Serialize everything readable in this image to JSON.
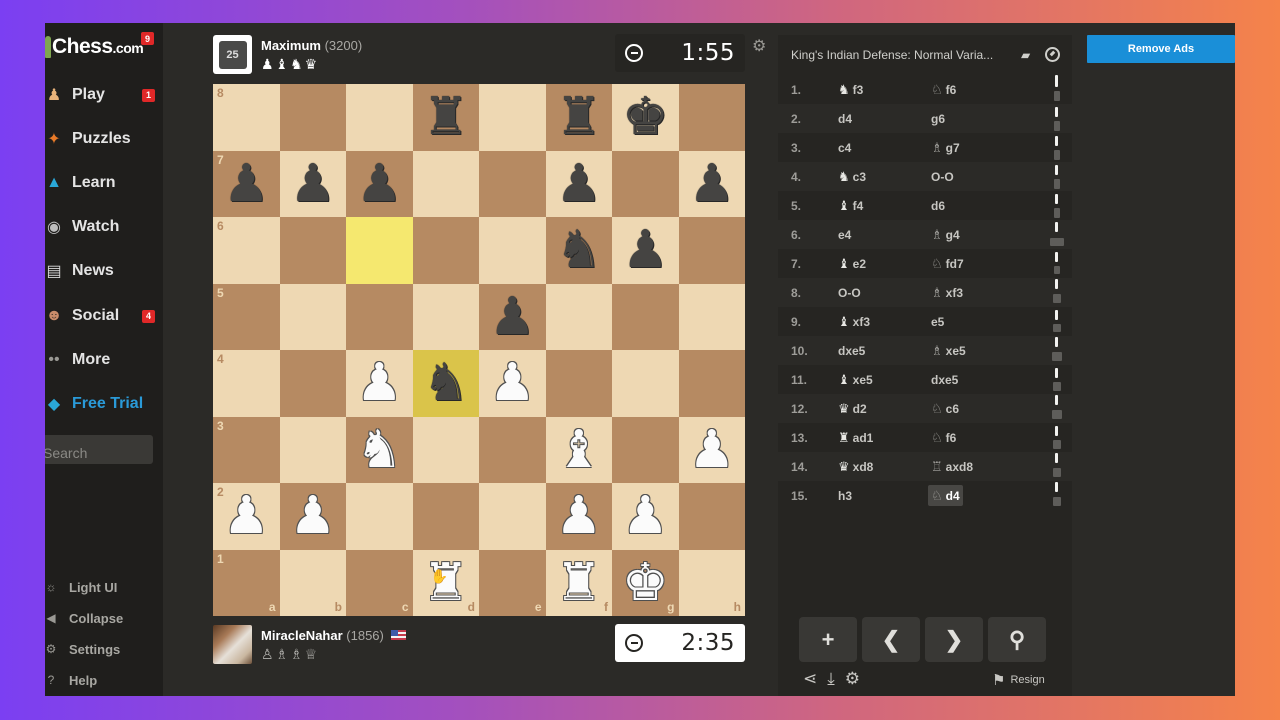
{
  "sidebar": {
    "logo": {
      "main": "Chess",
      "suffix": ".com",
      "badge": "9"
    },
    "items": [
      {
        "label": "Play",
        "icon": "play-icon",
        "glyph": "♟",
        "color": "#e7b27a",
        "badge": "1"
      },
      {
        "label": "Puzzles",
        "icon": "puzzle-icon",
        "glyph": "✦",
        "color": "#e87a28",
        "badge": null
      },
      {
        "label": "Learn",
        "icon": "graduation-cap-icon",
        "glyph": "▲",
        "color": "#2aa8d8",
        "badge": null
      },
      {
        "label": "Watch",
        "icon": "binoculars-icon",
        "glyph": "◉",
        "color": "#bdbdbd",
        "badge": null
      },
      {
        "label": "News",
        "icon": "newspaper-icon",
        "glyph": "▤",
        "color": "#d9d9d9",
        "badge": null
      },
      {
        "label": "Social",
        "icon": "people-icon",
        "glyph": "☻",
        "color": "#c98c6a",
        "badge": "4"
      },
      {
        "label": "More",
        "icon": "more-dots-icon",
        "glyph": "••",
        "color": "#9a9994",
        "badge": null
      },
      {
        "label": "Free Trial",
        "icon": "diamond-icon",
        "glyph": "◆",
        "color": "#2aa8d8",
        "badge": null
      }
    ],
    "search_placeholder": "Search",
    "footer": [
      {
        "label": "Light UI",
        "icon": "sun-icon",
        "glyph": "☼"
      },
      {
        "label": "Collapse",
        "icon": "arrow-left-icon",
        "glyph": "◀"
      },
      {
        "label": "Settings",
        "icon": "gear-icon",
        "glyph": "⚙"
      },
      {
        "label": "Help",
        "icon": "help-icon",
        "glyph": "?"
      }
    ]
  },
  "top_player": {
    "name": "Maximum",
    "rating": "(3200)",
    "avatar_level": "25",
    "captured": "♟♝♞♛",
    "clock": "1:55"
  },
  "bottom_player": {
    "name": "MiracleNahar",
    "rating": "(1856)",
    "captured": "♙♗♗♕",
    "clock": "2:35"
  },
  "board": {
    "ranks": [
      "8",
      "7",
      "6",
      "5",
      "4",
      "3",
      "2",
      "1"
    ],
    "files": [
      "a",
      "b",
      "c",
      "d",
      "e",
      "f",
      "g",
      "h"
    ],
    "position": [
      [
        "",
        "",
        "",
        "r",
        "",
        "r",
        "k",
        ""
      ],
      [
        "p",
        "p",
        "p",
        "",
        "",
        "p",
        "",
        "p"
      ],
      [
        "",
        "",
        "",
        "",
        "",
        "n",
        "p",
        ""
      ],
      [
        "",
        "",
        "",
        "",
        "p",
        "",
        "",
        ""
      ],
      [
        "",
        "",
        "P",
        "n",
        "P",
        "",
        "",
        ""
      ],
      [
        "",
        "",
        "N",
        "",
        "",
        "B",
        "",
        "P"
      ],
      [
        "P",
        "P",
        "",
        "",
        "",
        "P",
        "P",
        ""
      ],
      [
        "",
        "",
        "",
        "R",
        "",
        "R",
        "K",
        ""
      ]
    ],
    "highlights": [
      "c6",
      "d4"
    ]
  },
  "panel": {
    "opening": "King's Indian Defense: Normal Varia...",
    "moves": [
      {
        "n": "1.",
        "w": {
          "pc": "♞",
          "t": "f3"
        },
        "b": {
          "pc": "♘",
          "t": "f6"
        }
      },
      {
        "n": "2.",
        "w": {
          "pc": "",
          "t": "d4"
        },
        "b": {
          "pc": "",
          "t": "g6"
        }
      },
      {
        "n": "3.",
        "w": {
          "pc": "",
          "t": "c4"
        },
        "b": {
          "pc": "♗",
          "t": "g7"
        }
      },
      {
        "n": "4.",
        "w": {
          "pc": "♞",
          "t": "c3"
        },
        "b": {
          "pc": "",
          "t": "O-O"
        }
      },
      {
        "n": "5.",
        "w": {
          "pc": "♝",
          "t": "f4"
        },
        "b": {
          "pc": "",
          "t": "d6"
        }
      },
      {
        "n": "6.",
        "w": {
          "pc": "",
          "t": "e4"
        },
        "b": {
          "pc": "♗",
          "t": "g4"
        }
      },
      {
        "n": "7.",
        "w": {
          "pc": "♝",
          "t": "e2"
        },
        "b": {
          "pc": "♘",
          "t": "fd7"
        }
      },
      {
        "n": "8.",
        "w": {
          "pc": "",
          "t": "O-O"
        },
        "b": {
          "pc": "♗",
          "t": "xf3"
        }
      },
      {
        "n": "9.",
        "w": {
          "pc": "♝",
          "t": "xf3"
        },
        "b": {
          "pc": "",
          "t": "e5"
        }
      },
      {
        "n": "10.",
        "w": {
          "pc": "",
          "t": "dxe5"
        },
        "b": {
          "pc": "♗",
          "t": "xe5"
        }
      },
      {
        "n": "11.",
        "w": {
          "pc": "♝",
          "t": "xe5"
        },
        "b": {
          "pc": "",
          "t": "dxe5"
        }
      },
      {
        "n": "12.",
        "w": {
          "pc": "♛",
          "t": "d2"
        },
        "b": {
          "pc": "♘",
          "t": "c6"
        }
      },
      {
        "n": "13.",
        "w": {
          "pc": "♜",
          "t": "ad1"
        },
        "b": {
          "pc": "♘",
          "t": "f6"
        }
      },
      {
        "n": "14.",
        "w": {
          "pc": "♛",
          "t": "xd8"
        },
        "b": {
          "pc": "♖",
          "t": "axd8"
        }
      },
      {
        "n": "15.",
        "w": {
          "pc": "",
          "t": "h3"
        },
        "b": {
          "pc": "♘",
          "t": "d4"
        }
      }
    ],
    "active_move": "15.b",
    "controls": [
      {
        "name": "add-move-button",
        "glyph": "+"
      },
      {
        "name": "previous-move-button",
        "glyph": "❮"
      },
      {
        "name": "next-move-button",
        "glyph": "❯"
      },
      {
        "name": "analysis-button",
        "glyph": "⚲"
      }
    ],
    "resign_label": "Resign"
  },
  "remove_ads_label": "Remove Ads"
}
